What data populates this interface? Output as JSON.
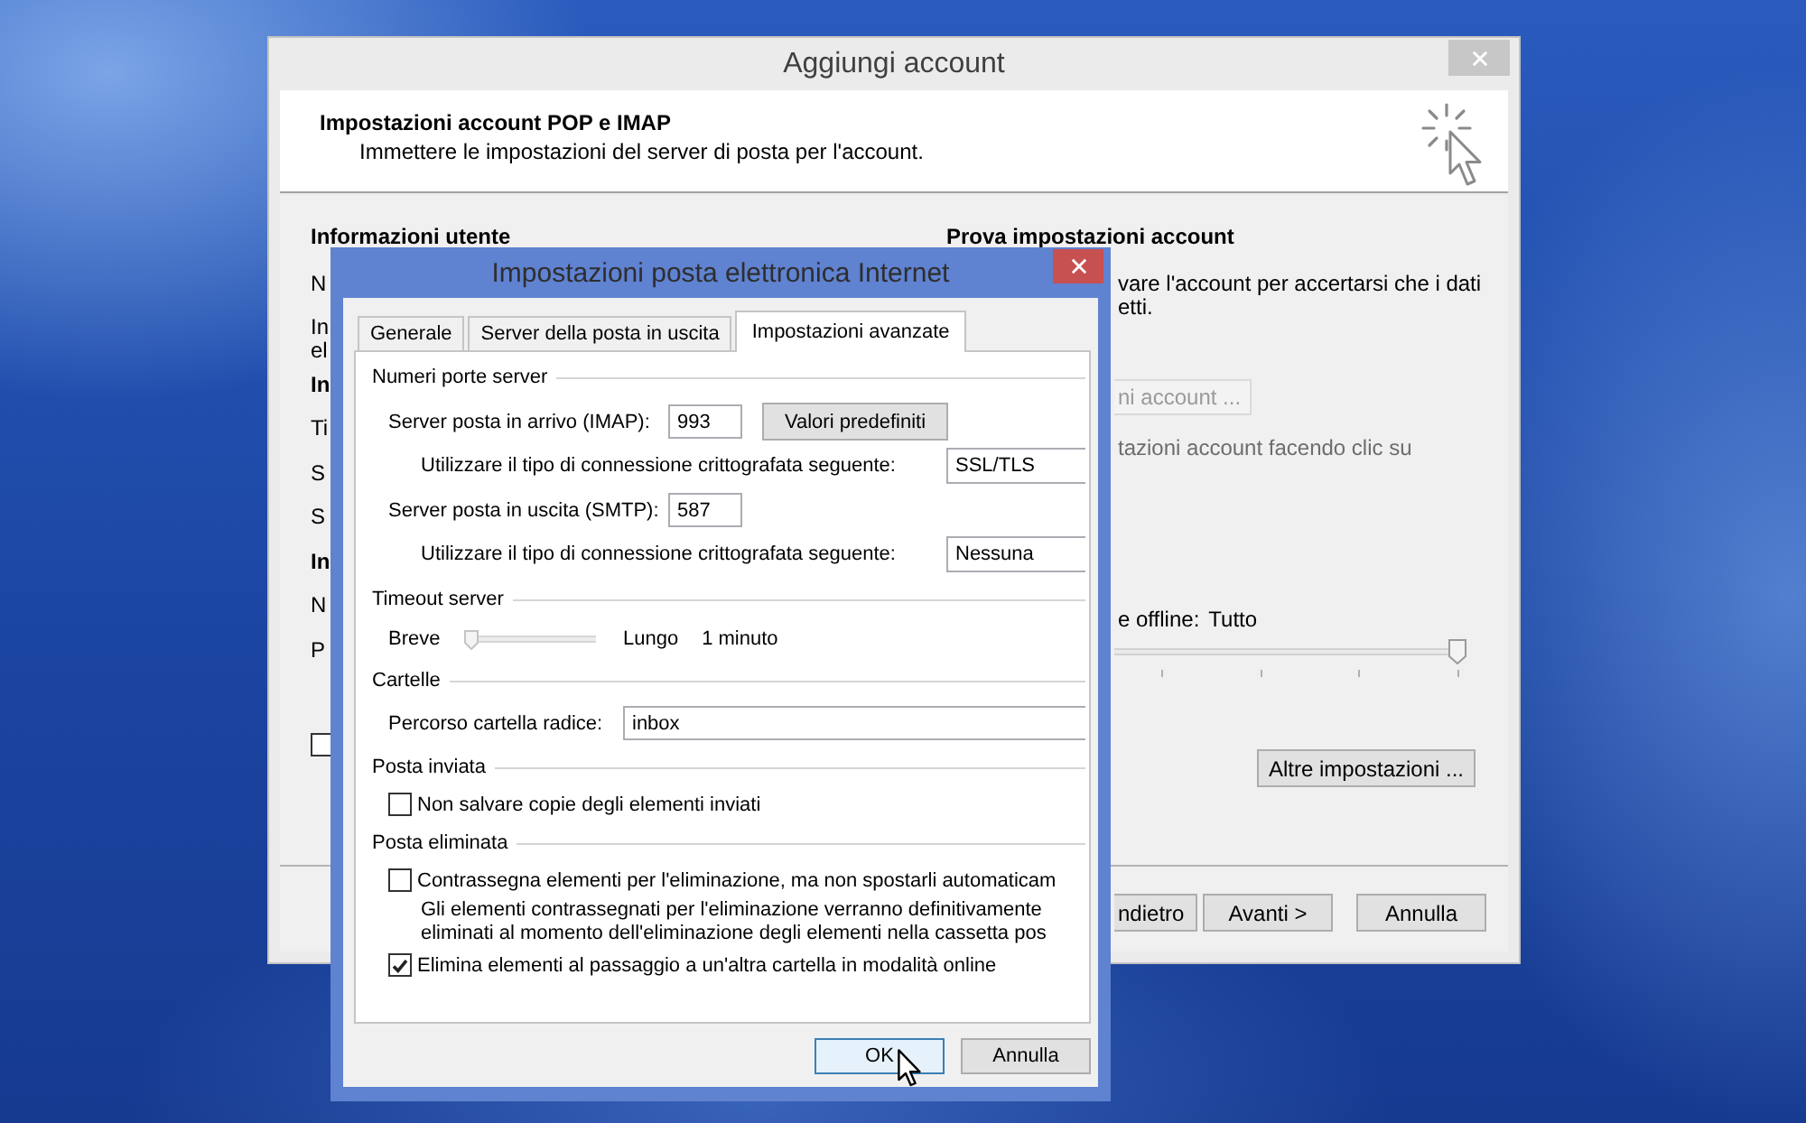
{
  "add_account_window": {
    "title": "Aggiungi account",
    "header": {
      "title": "Impostazioni account POP e IMAP",
      "subtitle": "Immettere le impostazioni del server di posta per l'account."
    },
    "left_column": {
      "heading": "Informazioni utente",
      "items": [
        {
          "kind": "label",
          "text": "N"
        },
        {
          "kind": "label",
          "text": "In el"
        },
        {
          "kind": "heading",
          "text": "In"
        },
        {
          "kind": "label",
          "text": "Ti"
        },
        {
          "kind": "label",
          "text": "S"
        },
        {
          "kind": "label",
          "text": "S"
        },
        {
          "kind": "heading",
          "text": "In"
        },
        {
          "kind": "label",
          "text": "N"
        },
        {
          "kind": "label",
          "text": "P"
        },
        {
          "kind": "checkbox",
          "checked": false
        }
      ]
    },
    "right_column": {
      "heading": "Prova impostazioni account",
      "description_lines": [
        "vare l'account per accertarsi che i dati",
        "etti."
      ],
      "test_button": {
        "label": "ni account ...",
        "disabled": true
      },
      "auto_test": {
        "label": "tazioni account facendo clic su",
        "disabled": true
      },
      "offline": {
        "label": "e offline:",
        "value": "Tutto",
        "level": 1
      },
      "more_settings_button": "Altre impostazioni ..."
    },
    "buttons": [
      {
        "label": "ndietro"
      },
      {
        "label": "Avanti >"
      },
      {
        "label": "Annulla"
      }
    ]
  },
  "internet_settings_window": {
    "title": "Impostazioni posta elettronica Internet",
    "tabs": [
      {
        "label": "Generale",
        "selected": false
      },
      {
        "label": "Server della posta in uscita",
        "selected": false
      },
      {
        "label": "Impostazioni avanzate",
        "selected": true
      }
    ],
    "sections": [
      {
        "title": "Numeri porte server",
        "rows": [
          {
            "kind": "port",
            "label": "Server posta in arrivo (IMAP):",
            "value": "993",
            "button": "Valori predefiniti"
          },
          {
            "kind": "select",
            "label": "Utilizzare il tipo di connessione crittografata seguente:",
            "value": "SSL/TLS"
          },
          {
            "kind": "port",
            "label": "Server posta in uscita (SMTP):",
            "value": "587"
          },
          {
            "kind": "select",
            "label": "Utilizzare il tipo di connessione crittografata seguente:",
            "value": "Nessuna"
          }
        ]
      },
      {
        "title": "Timeout server",
        "rows": [
          {
            "kind": "slider",
            "min_label": "Breve",
            "max_label": "Lungo",
            "reading": "1 minuto",
            "level": 0
          }
        ]
      },
      {
        "title": "Cartelle",
        "rows": [
          {
            "kind": "text",
            "label": "Percorso cartella radice:",
            "value": "inbox"
          }
        ]
      },
      {
        "title": "Posta inviata",
        "rows": [
          {
            "kind": "checkbox",
            "label": "Non salvare copie degli elementi inviati",
            "checked": false
          }
        ]
      },
      {
        "title": "Posta eliminata",
        "rows": [
          {
            "kind": "checkbox",
            "label": "Contrassegna elementi per l'eliminazione, ma non spostarli automaticam",
            "checked": false
          },
          {
            "kind": "note",
            "lines": [
              "Gli elementi contrassegnati per l'eliminazione verranno definitivamente",
              "eliminati al momento dell'eliminazione degli elementi nella cassetta pos"
            ]
          },
          {
            "kind": "checkbox",
            "label": "Elimina elementi al passaggio a un'altra cartella in modalità online",
            "checked": true
          }
        ]
      }
    ],
    "buttons": [
      {
        "label": "OK",
        "default": true
      },
      {
        "label": "Annulla",
        "default": false
      }
    ]
  }
}
